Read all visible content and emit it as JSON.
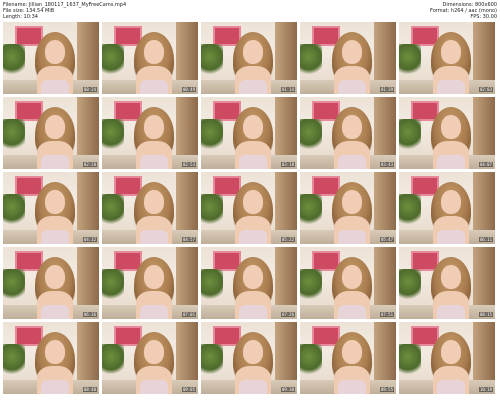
{
  "header": {
    "left": [
      "Filename: Jillian_180117_1637_MyFreeCams.mp4",
      "File size: 134.54 MiB",
      "Length: 10:34"
    ],
    "right": [
      "Dimensions: 800x600",
      "Format: h264 / aac (mono)",
      "FPS: 30.00"
    ]
  },
  "thumbnails": [
    {
      "time": "00:24"
    },
    {
      "time": "00:49"
    },
    {
      "time": "01:14"
    },
    {
      "time": "01:39"
    },
    {
      "time": "02:03"
    },
    {
      "time": "02:28"
    },
    {
      "time": "02:53"
    },
    {
      "time": "03:18"
    },
    {
      "time": "03:43"
    },
    {
      "time": "04:07"
    },
    {
      "time": "04:32"
    },
    {
      "time": "04:57"
    },
    {
      "time": "05:22"
    },
    {
      "time": "05:47"
    },
    {
      "time": "06:11"
    },
    {
      "time": "06:36"
    },
    {
      "time": "07:01"
    },
    {
      "time": "07:26"
    },
    {
      "time": "07:51"
    },
    {
      "time": "08:15"
    },
    {
      "time": "08:40"
    },
    {
      "time": "09:05"
    },
    {
      "time": "09:30"
    },
    {
      "time": "09:55"
    },
    {
      "time": "10:19"
    }
  ]
}
